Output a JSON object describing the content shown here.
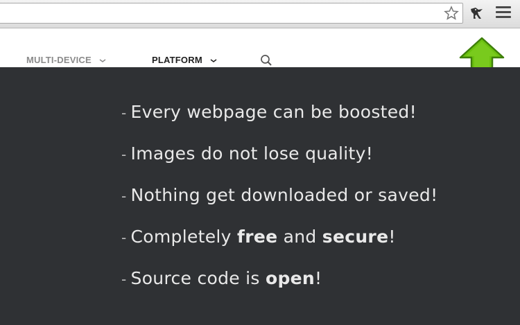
{
  "browser": {
    "toolbar_icons": [
      "star-icon",
      "extension-icon",
      "menu-icon"
    ]
  },
  "nav": {
    "items": [
      {
        "label": "MULTI-DEVICE",
        "icon": "chevron-down-icon"
      },
      {
        "label": "PLATFORM",
        "icon": "chevron-down-icon"
      }
    ],
    "search_icon": "search-icon"
  },
  "callout": {
    "icon": "up-arrow-icon",
    "color": "#6cc10f"
  },
  "features": [
    {
      "dash": "-",
      "parts": [
        "Every webpage can be boosted!"
      ]
    },
    {
      "dash": "-",
      "parts": [
        "Images do not lose quality!"
      ]
    },
    {
      "dash": "-",
      "parts": [
        "Nothing get downloaded or saved!"
      ]
    },
    {
      "dash": "-",
      "parts": [
        "Completely ",
        "free",
        " and ",
        "secure",
        "!"
      ]
    },
    {
      "dash": "-",
      "parts": [
        "Source code is ",
        "open",
        "!"
      ]
    }
  ],
  "colors": {
    "background": "#2f3134",
    "text": "#e9e9e9",
    "accent": "#6cc10f"
  }
}
